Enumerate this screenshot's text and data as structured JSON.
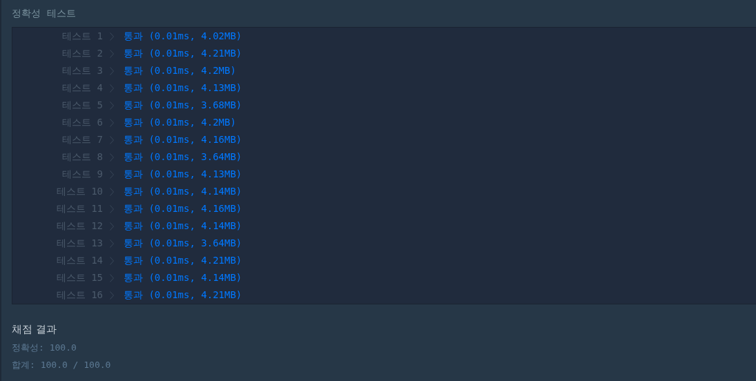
{
  "section_title": "정확성  테스트",
  "tests": [
    {
      "label": "테스트 1",
      "result": "통과 (0.01ms, 4.02MB)",
      "passed": true
    },
    {
      "label": "테스트 2",
      "result": "통과 (0.01ms, 4.21MB)",
      "passed": true
    },
    {
      "label": "테스트 3",
      "result": "통과 (0.01ms, 4.2MB)",
      "passed": true
    },
    {
      "label": "테스트 4",
      "result": "통과 (0.01ms, 4.13MB)",
      "passed": true
    },
    {
      "label": "테스트 5",
      "result": "통과 (0.01ms, 3.68MB)",
      "passed": true
    },
    {
      "label": "테스트 6",
      "result": "통과 (0.01ms, 4.2MB)",
      "passed": true
    },
    {
      "label": "테스트 7",
      "result": "통과 (0.01ms, 4.16MB)",
      "passed": true
    },
    {
      "label": "테스트 8",
      "result": "통과 (0.01ms, 3.64MB)",
      "passed": true
    },
    {
      "label": "테스트 9",
      "result": "통과 (0.01ms, 4.13MB)",
      "passed": true
    },
    {
      "label": "테스트 10",
      "result": "통과 (0.01ms, 4.14MB)",
      "passed": true
    },
    {
      "label": "테스트 11",
      "result": "통과 (0.01ms, 4.16MB)",
      "passed": true
    },
    {
      "label": "테스트 12",
      "result": "통과 (0.01ms, 4.14MB)",
      "passed": true
    },
    {
      "label": "테스트 13",
      "result": "통과 (0.01ms, 3.64MB)",
      "passed": true
    },
    {
      "label": "테스트 14",
      "result": "통과 (0.01ms, 4.21MB)",
      "passed": true
    },
    {
      "label": "테스트 15",
      "result": "통과 (0.01ms, 4.14MB)",
      "passed": true
    },
    {
      "label": "테스트 16",
      "result": "통과 (0.01ms, 4.21MB)",
      "passed": true
    }
  ],
  "summary": {
    "title": "채점 결과",
    "lines": [
      "정확성: 100.0",
      "합계: 100.0 / 100.0"
    ]
  }
}
